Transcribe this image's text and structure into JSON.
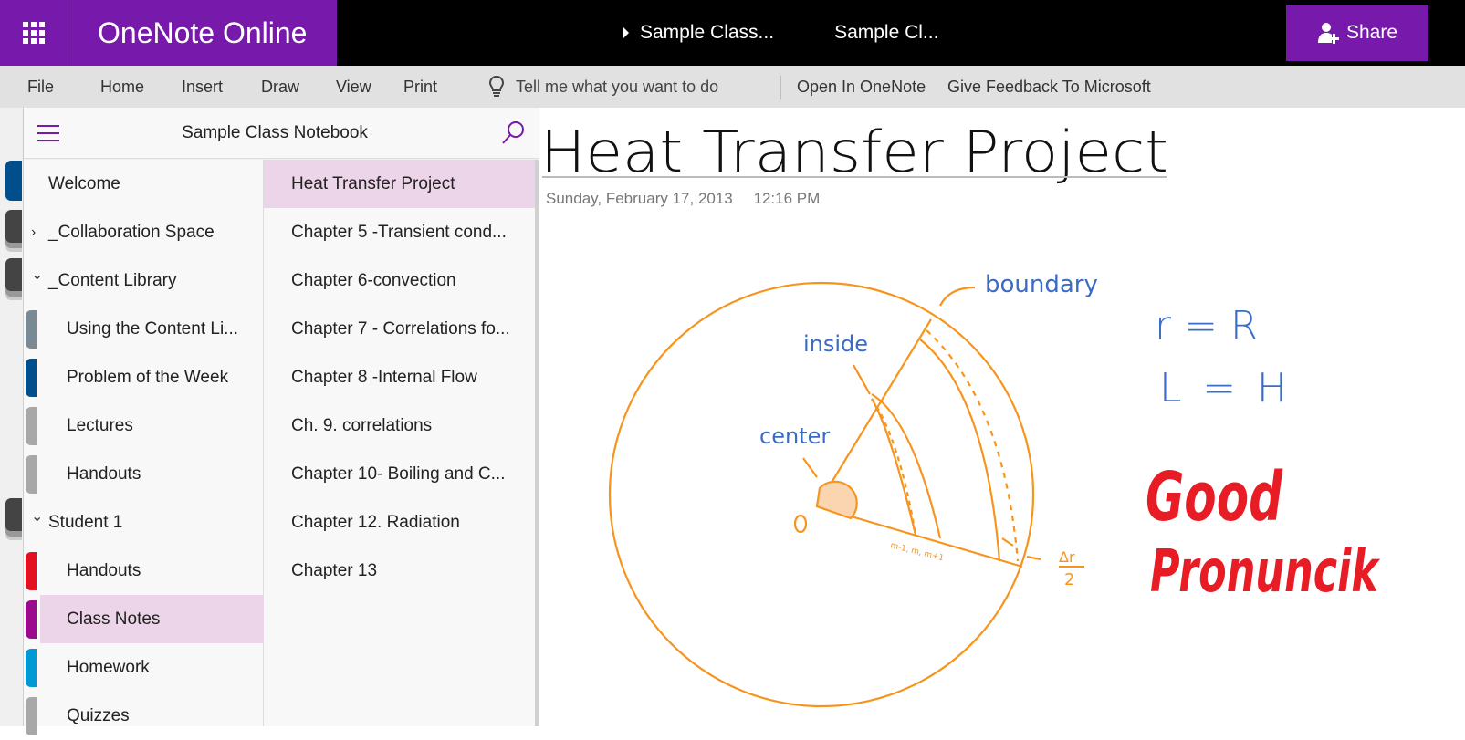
{
  "app": {
    "title": "OneNote Online",
    "breadcrumbs": [
      "Sample Class...",
      "Sample Cl..."
    ],
    "share_label": "Share",
    "accent_color": "#7719aa"
  },
  "ribbon": {
    "tabs": [
      "File",
      "Home",
      "Insert",
      "Draw",
      "View",
      "Print"
    ],
    "tell_me_placeholder": "Tell me what you want to do",
    "open_in_onenote": "Open In OneNote",
    "give_feedback": "Give Feedback To Microsoft"
  },
  "notebook": {
    "title": "Sample Class Notebook"
  },
  "sections": [
    {
      "label": "Welcome",
      "level": 0,
      "expander": "",
      "color": ""
    },
    {
      "label": "_Collaboration Space",
      "level": 0,
      "expander": "collapsed",
      "color": ""
    },
    {
      "label": "_Content Library",
      "level": 0,
      "expander": "expanded",
      "color": ""
    },
    {
      "label": "Using the Content Li...",
      "level": 1,
      "expander": "",
      "color": "#7a8a94"
    },
    {
      "label": "Problem of the Week",
      "level": 1,
      "expander": "",
      "color": "#004e8c"
    },
    {
      "label": "Lectures",
      "level": 1,
      "expander": "",
      "color": "#a8a8a8"
    },
    {
      "label": "Handouts",
      "level": 1,
      "expander": "",
      "color": "#a8a8a8"
    },
    {
      "label": "Student 1",
      "level": 0,
      "expander": "expanded",
      "color": ""
    },
    {
      "label": "Handouts",
      "level": 1,
      "expander": "",
      "color": "#e3101f"
    },
    {
      "label": "Class Notes",
      "level": 1,
      "expander": "",
      "color": "#9b0a8c",
      "selected": true
    },
    {
      "label": "Homework",
      "level": 1,
      "expander": "",
      "color": "#0099d3"
    },
    {
      "label": "Quizzes",
      "level": 1,
      "expander": "",
      "color": "#a8a8a8"
    }
  ],
  "pages": [
    {
      "label": "Heat Transfer Project",
      "selected": true
    },
    {
      "label": "Chapter 5 -Transient cond..."
    },
    {
      "label": "Chapter 6-convection"
    },
    {
      "label": "Chapter 7 - Correlations fo..."
    },
    {
      "label": "Chapter 8 -Internal Flow"
    },
    {
      "label": "Ch. 9. correlations"
    },
    {
      "label": "Chapter 10- Boiling and C..."
    },
    {
      "label": "Chapter 12. Radiation"
    },
    {
      "label": "Chapter 13"
    }
  ],
  "page": {
    "title": "Heat Transfer Project",
    "date": "Sunday, February 17, 2013",
    "time": "12:16 PM",
    "ink_labels": {
      "boundary": "boundary",
      "inside": "inside",
      "center": "center",
      "origin": "O",
      "nodes": "m-1, m, m+1",
      "delta_r_num": "Δr",
      "delta_r_den": "2",
      "eq1": "r = R",
      "eq2": "L = H",
      "comment_line1": "Good",
      "comment_line2": "Pronuncik"
    },
    "ink_colors": {
      "diagram": "#f7941d",
      "notes": "#3a6cc6",
      "comment": "#e81c24",
      "title": "#111111"
    }
  }
}
